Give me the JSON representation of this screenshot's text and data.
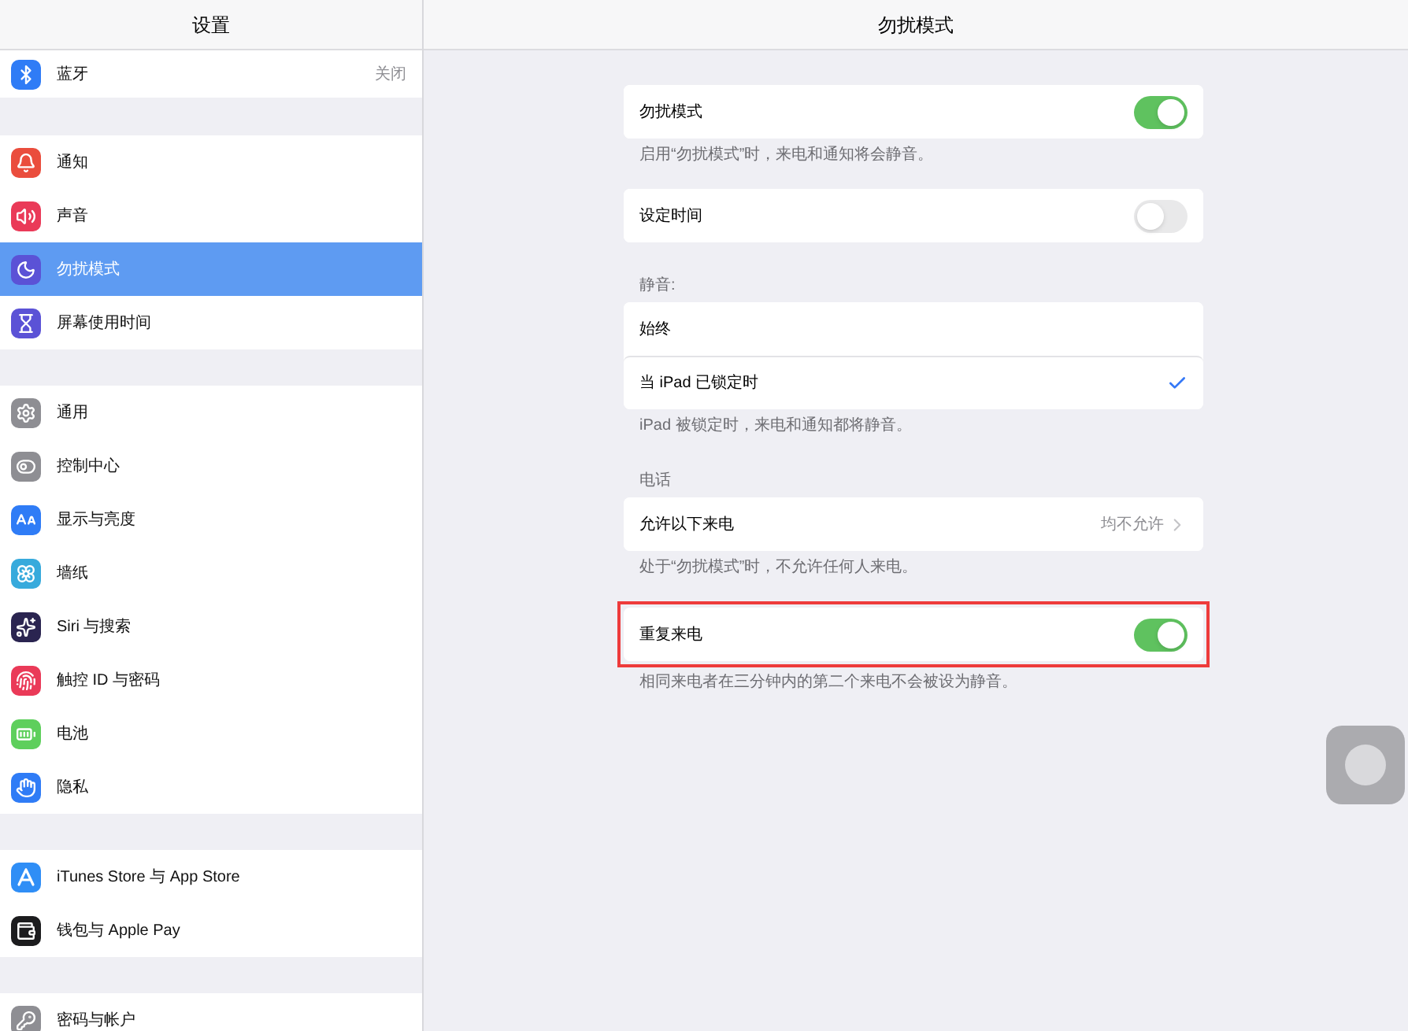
{
  "sidebar": {
    "title": "设置",
    "groups": [
      [
        {
          "label": "蓝牙",
          "value": "关闭",
          "selected": false
        }
      ],
      [
        {
          "label": "通知",
          "selected": false
        },
        {
          "label": "声音",
          "selected": false
        },
        {
          "label": "勿扰模式",
          "selected": true
        },
        {
          "label": "屏幕使用时间",
          "selected": false
        }
      ],
      [
        {
          "label": "通用",
          "selected": false
        },
        {
          "label": "控制中心",
          "selected": false
        },
        {
          "label": "显示与亮度",
          "selected": false
        },
        {
          "label": "墙纸",
          "selected": false
        },
        {
          "label": "Siri 与搜索",
          "selected": false
        },
        {
          "label": "触控 ID 与密码",
          "selected": false
        },
        {
          "label": "电池",
          "selected": false
        },
        {
          "label": "隐私",
          "selected": false
        }
      ],
      [
        {
          "label": "iTunes Store 与 App Store",
          "selected": false
        },
        {
          "label": "钱包与 Apple Pay",
          "selected": false
        }
      ],
      [
        {
          "label": "密码与帐户",
          "selected": false
        }
      ]
    ]
  },
  "detail": {
    "title": "勿扰模式",
    "sections": [
      {
        "highlighted": false,
        "rows": [
          {
            "kind": "toggle",
            "label": "勿扰模式",
            "on": true
          }
        ],
        "footer": "启用“勿扰模式”时，来电和通知将会静音。"
      },
      {
        "highlighted": false,
        "rows": [
          {
            "kind": "toggle",
            "label": "设定时间",
            "on": false
          }
        ]
      },
      {
        "header": "静音:",
        "highlighted": false,
        "rows": [
          {
            "kind": "check",
            "label": "始终",
            "selected": false
          },
          {
            "kind": "check",
            "label": "当 iPad 已锁定时",
            "selected": true
          }
        ],
        "footer": "iPad 被锁定时，来电和通知都将静音。"
      },
      {
        "header": "电话",
        "highlighted": false,
        "rows": [
          {
            "kind": "link",
            "label": "允许以下来电",
            "value": "均不允许"
          }
        ],
        "footer": "处于“勿扰模式”时，不允许任何人来电。"
      },
      {
        "highlighted": true,
        "rows": [
          {
            "kind": "toggle",
            "label": "重复来电",
            "on": true
          }
        ],
        "footer": "相同来电者在三分钟内的第二个来电不会被设为静音。"
      }
    ]
  }
}
